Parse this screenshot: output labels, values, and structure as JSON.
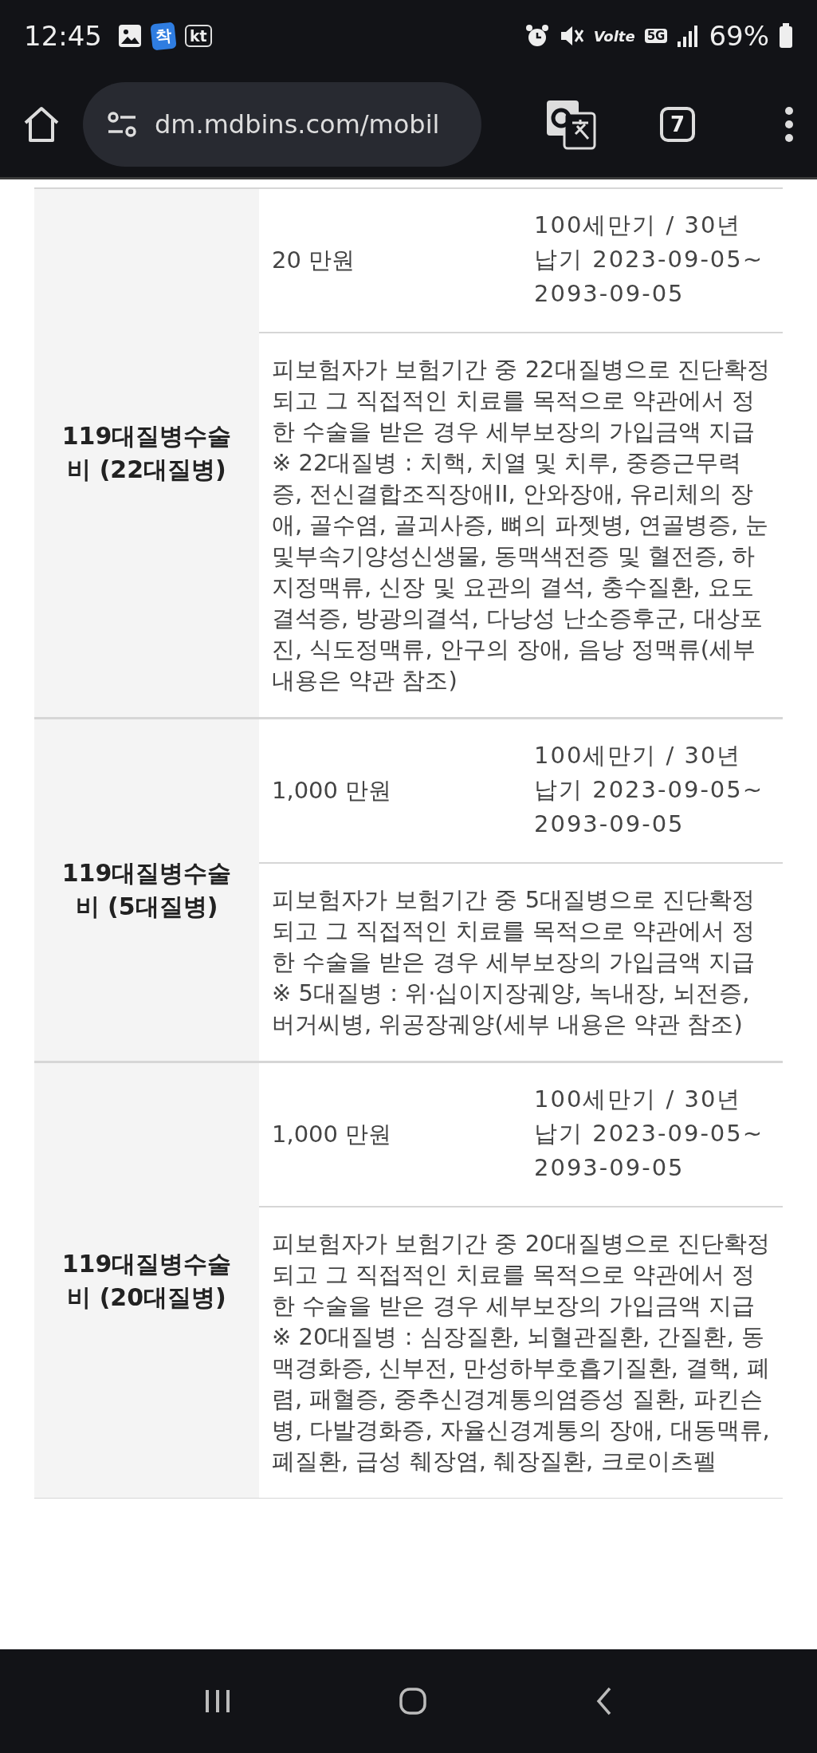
{
  "status_bar": {
    "time": "12:45",
    "notification_badges": [
      "착",
      "kt"
    ],
    "network_labels": [
      "Volte",
      "5G"
    ],
    "battery": "69%"
  },
  "address_bar": {
    "url": "dm.mdbins.com/mobil",
    "tab_count": "7"
  },
  "coverage_rows": [
    {
      "label": "119대질병수술비 (22대질병)",
      "amount": "20 만원",
      "period": "100세만기 / 30년 납기 2023-09-05~2093-09-05",
      "description": "피보험자가 보험기간 중 22대질병으로 진단확정되고 그 직접적인 치료를 목적으로 약관에서 정한 수술을 받은 경우 세부보장의 가입금액 지급 ※ 22대질병 : 치핵, 치열 및 치루, 중증근무력증, 전신결합조직장애II, 안와장애, 유리체의 장애, 골수염, 골괴사증, 뼈의 파젯병, 연골병증, 눈및부속기양성신생물, 동맥색전증 및 혈전증, 하지정맥류, 신장 및 요관의 결석, 충수질환, 요도결석증, 방광의결석, 다낭성 난소증후군, 대상포진, 식도정맥류, 안구의 장애, 음낭 정맥류(세부 내용은 약관 참조)"
    },
    {
      "label": "119대질병수술비 (5대질병)",
      "amount": "1,000 만원",
      "period": "100세만기 / 30년 납기 2023-09-05~2093-09-05",
      "description": "피보험자가 보험기간 중 5대질병으로 진단확정되고 그 직접적인 치료를 목적으로 약관에서 정한 수술을 받은 경우 세부보장의 가입금액 지급 ※ 5대질병 : 위·십이지장궤양, 녹내장, 뇌전증, 버거씨병, 위공장궤양(세부 내용은 약관 참조)"
    },
    {
      "label": "119대질병수술비 (20대질병)",
      "amount": "1,000 만원",
      "period": "100세만기 / 30년 납기 2023-09-05~2093-09-05",
      "description": "피보험자가 보험기간 중 20대질병으로 진단확정되고 그 직접적인 치료를 목적으로 약관에서 정한 수술을 받은 경우 세부보장의 가입금액 지급 ※ 20대질병 : 심장질환, 뇌혈관질환, 간질환, 동맥경화증, 신부전, 만성하부호흡기질환, 결핵, 폐렴, 패혈증, 중추신경계통의염증성 질환, 파킨슨병, 다발경화증, 자율신경계통의 장애, 대동맥류, 폐질환, 급성 췌장염, 췌장질환, 크로이츠펠"
    }
  ]
}
